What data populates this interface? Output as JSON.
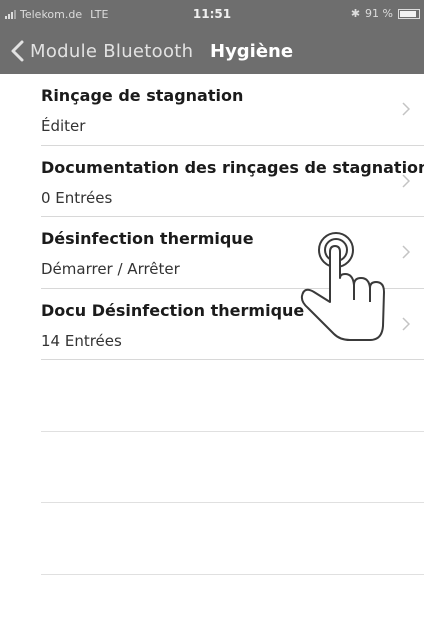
{
  "status": {
    "carrier": "Telekom.de",
    "network": "LTE",
    "time": "11:51",
    "bluetooth_symbol": "✱",
    "battery_percent": "91 %",
    "battery_level": 0.91
  },
  "nav": {
    "back_label": "Module Bluetooth",
    "title": "Hygiène"
  },
  "items": [
    {
      "title": "Rinçage de stagnation",
      "subtitle": "Éditer"
    },
    {
      "title": "Documentation des rinçages de stagnation",
      "subtitle": "0 Entrées"
    },
    {
      "title": "Désinfection thermique",
      "subtitle": "Démarrer / Arrêter"
    },
    {
      "title": "Docu Désinfection thermique",
      "subtitle": "14 Entrées"
    }
  ],
  "icons": {
    "back": "chevron-left-icon",
    "row": "chevron-right-icon",
    "overlay": "tap-hand-icon"
  },
  "colors": {
    "header_bg": "#6e6e6e",
    "chevron": "#c4c4c4"
  }
}
